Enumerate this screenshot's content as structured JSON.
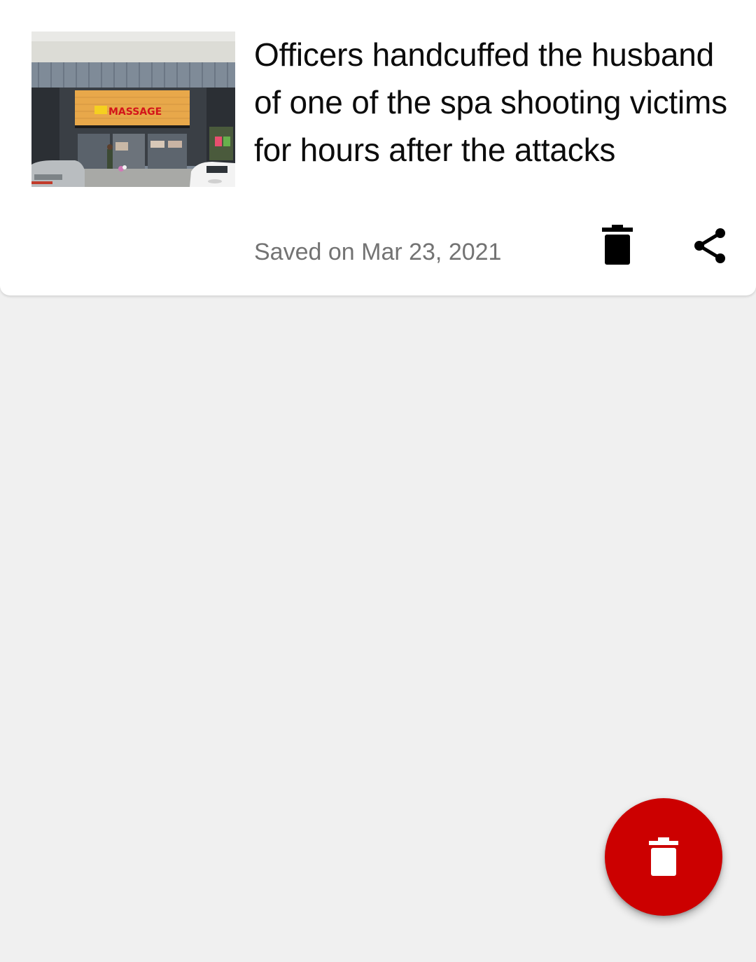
{
  "saved_item": {
    "thumbnail_sign_text": "MASSAGE",
    "headline": "Officers handcuffed the husband of one of the spa shooting victims for hours after the attacks",
    "saved_date": "Saved on Mar 23, 2021",
    "delete_icon": "trash-icon",
    "share_icon": "share-icon"
  },
  "fab": {
    "icon": "trash-icon"
  },
  "colors": {
    "background": "#f0f0f0",
    "card": "#ffffff",
    "accent_red": "#cc0000",
    "headline_text": "#0c0c0c",
    "meta_text": "#737373"
  }
}
